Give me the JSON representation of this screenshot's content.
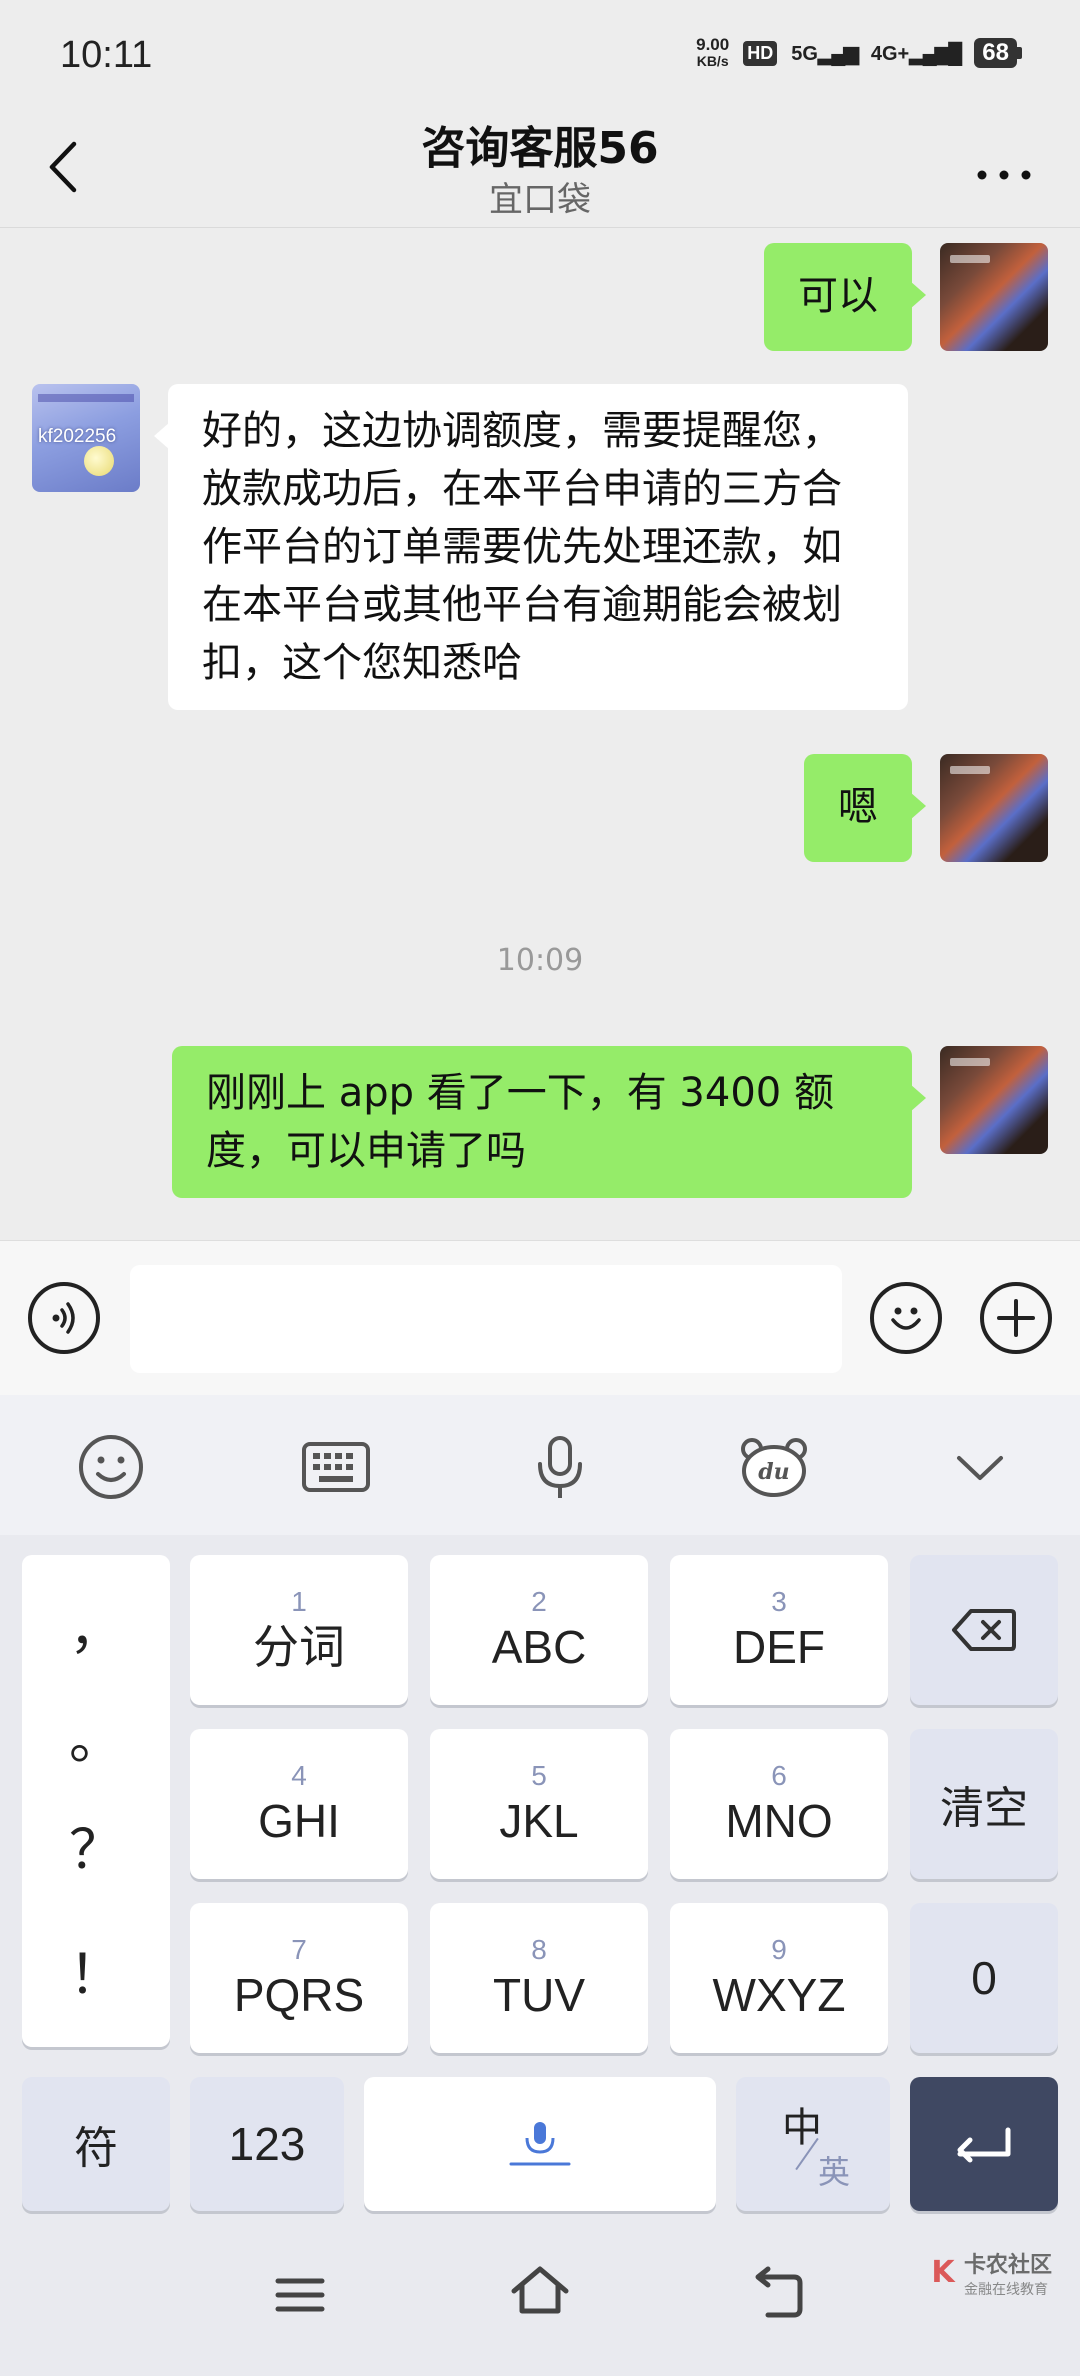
{
  "status_bar": {
    "time": "10:11",
    "net_speed_value": "9.00",
    "net_speed_unit": "KB/s",
    "hd_label": "HD",
    "sig1_label": "5G",
    "sig2_label": "4G+",
    "battery": "68"
  },
  "header": {
    "title": "咨询客服56",
    "subtitle": "宜口袋"
  },
  "messages": [
    {
      "side": "right",
      "text": "可以"
    },
    {
      "side": "left",
      "text": "好的，这边协调额度，需要提醒您，放款成功后，在本平台申请的三方合作平台的订单需要优先处理还款，如在本平台或其他平台有逾期能会被划扣，这个您知悉哈"
    },
    {
      "side": "right",
      "text": "嗯"
    },
    {
      "side": "right",
      "text": "刚刚上 app 看了一下，有 3400 额度，可以申请了吗"
    }
  ],
  "other_avatar_text": "kf202256",
  "timestamp": "10:09",
  "keyboard": {
    "punct": [
      "，",
      "。",
      "？",
      "！"
    ],
    "rows": [
      [
        {
          "num": "1",
          "letters": "分词"
        },
        {
          "num": "2",
          "letters": "ABC"
        },
        {
          "num": "3",
          "letters": "DEF"
        }
      ],
      [
        {
          "num": "4",
          "letters": "GHI"
        },
        {
          "num": "5",
          "letters": "JKL"
        },
        {
          "num": "6",
          "letters": "MNO"
        }
      ],
      [
        {
          "num": "7",
          "letters": "PQRS"
        },
        {
          "num": "8",
          "letters": "TUV"
        },
        {
          "num": "9",
          "letters": "WXYZ"
        }
      ]
    ],
    "clear_label": "清空",
    "zero_label": "0",
    "symbol_label": "符",
    "num_label": "123",
    "zh_label": "中",
    "en_label": "英"
  },
  "watermark": {
    "brand": "卡农社区",
    "sub": "金融在线教育"
  }
}
